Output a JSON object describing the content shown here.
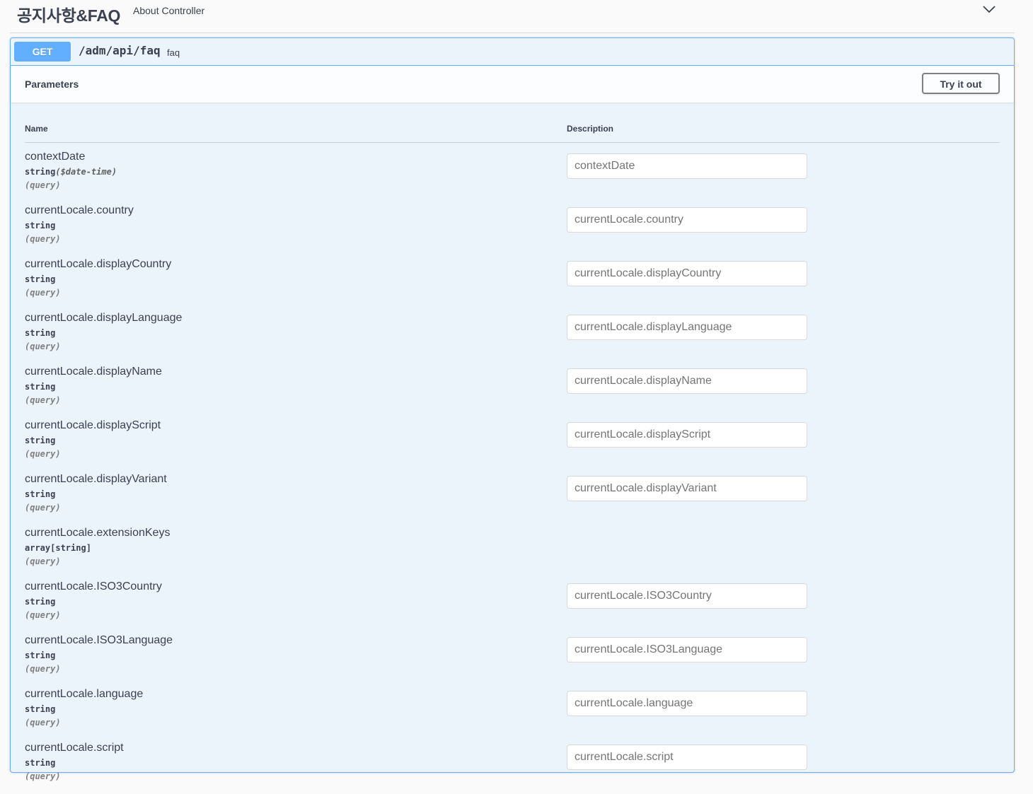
{
  "tag": {
    "name": "공지사항&FAQ",
    "description": "About Controller",
    "toggle_icon": "chevron-down-icon"
  },
  "operation": {
    "method": "GET",
    "path": "/adm/api/faq",
    "description": "faq",
    "method_color": "#61affe"
  },
  "parameters_section": {
    "title": "Parameters",
    "try_it_out_label": "Try it out",
    "column_name": "Name",
    "column_description": "Description"
  },
  "parameters": [
    {
      "name": "contextDate",
      "type": "string",
      "format": "($date-time)",
      "in": "(query)",
      "placeholder": "contextDate",
      "has_input": true
    },
    {
      "name": "currentLocale.country",
      "type": "string",
      "format": "",
      "in": "(query)",
      "placeholder": "currentLocale.country",
      "has_input": true
    },
    {
      "name": "currentLocale.displayCountry",
      "type": "string",
      "format": "",
      "in": "(query)",
      "placeholder": "currentLocale.displayCountry",
      "has_input": true
    },
    {
      "name": "currentLocale.displayLanguage",
      "type": "string",
      "format": "",
      "in": "(query)",
      "placeholder": "currentLocale.displayLanguage",
      "has_input": true
    },
    {
      "name": "currentLocale.displayName",
      "type": "string",
      "format": "",
      "in": "(query)",
      "placeholder": "currentLocale.displayName",
      "has_input": true
    },
    {
      "name": "currentLocale.displayScript",
      "type": "string",
      "format": "",
      "in": "(query)",
      "placeholder": "currentLocale.displayScript",
      "has_input": true
    },
    {
      "name": "currentLocale.displayVariant",
      "type": "string",
      "format": "",
      "in": "(query)",
      "placeholder": "currentLocale.displayVariant",
      "has_input": true
    },
    {
      "name": "currentLocale.extensionKeys",
      "type": "array[string]",
      "format": "",
      "in": "(query)",
      "placeholder": "",
      "has_input": false
    },
    {
      "name": "currentLocale.ISO3Country",
      "type": "string",
      "format": "",
      "in": "(query)",
      "placeholder": "currentLocale.ISO3Country",
      "has_input": true
    },
    {
      "name": "currentLocale.ISO3Language",
      "type": "string",
      "format": "",
      "in": "(query)",
      "placeholder": "currentLocale.ISO3Language",
      "has_input": true
    },
    {
      "name": "currentLocale.language",
      "type": "string",
      "format": "",
      "in": "(query)",
      "placeholder": "currentLocale.language",
      "has_input": true
    },
    {
      "name": "currentLocale.script",
      "type": "string",
      "format": "",
      "in": "(query)",
      "placeholder": "currentLocale.script",
      "has_input": true
    }
  ]
}
